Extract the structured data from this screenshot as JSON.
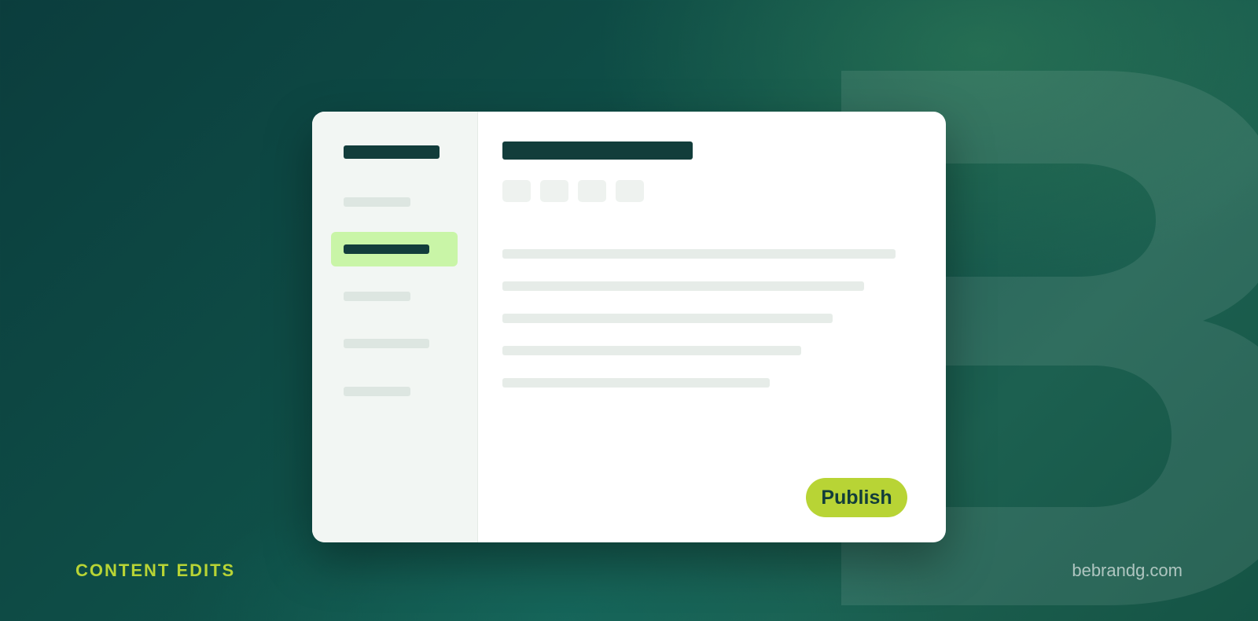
{
  "caption": "CONTENT EDITS",
  "site": "bebrandg.com",
  "editor": {
    "publish_label": "Publish"
  },
  "colors": {
    "accent": "#b8d435",
    "dark": "#123d3b",
    "active_item": "#c9f5a7",
    "background": "#0f5048"
  }
}
